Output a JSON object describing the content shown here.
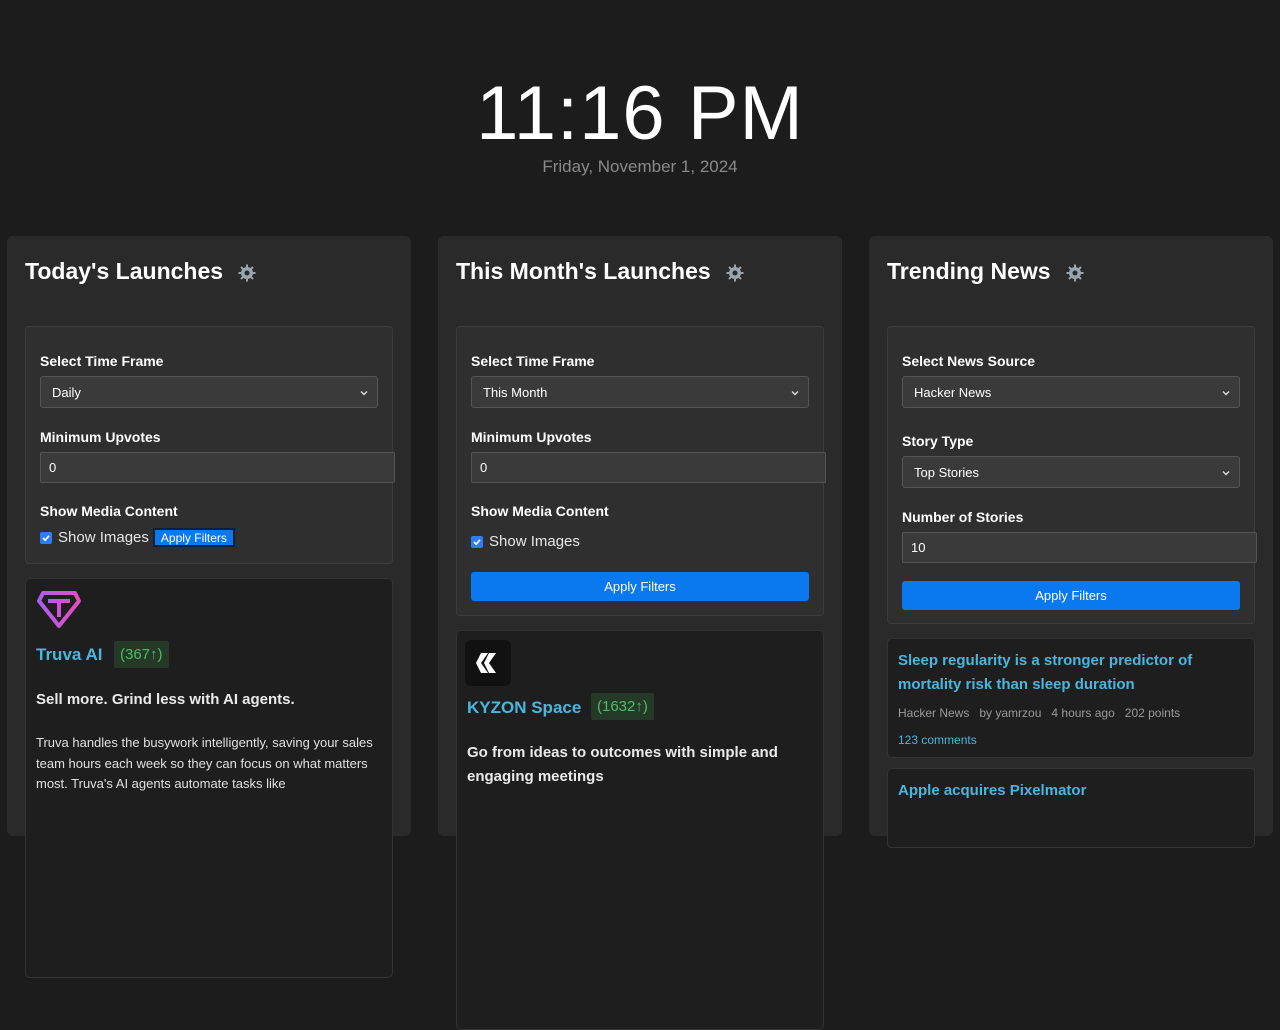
{
  "clock": {
    "time": "11:16 PM",
    "date": "Friday, November 1, 2024"
  },
  "panels": [
    {
      "title": "Today's Launches",
      "filters": {
        "timeframe_label": "Select Time Frame",
        "timeframe_value": "Daily",
        "upvotes_label": "Minimum Upvotes",
        "upvotes_value": "0",
        "media_label": "Show Media Content",
        "show_images_label": "Show Images",
        "apply_label": "Apply Filters"
      },
      "card": {
        "name": "Truva AI",
        "votes": "(367↑)",
        "tagline": "Sell more. Grind less with AI agents.",
        "description": "Truva handles the busywork intelligently, saving your sales team hours each week so they can focus on what matters most. Truva's AI agents automate tasks like"
      }
    },
    {
      "title": "This Month's Launches",
      "filters": {
        "timeframe_label": "Select Time Frame",
        "timeframe_value": "This Month",
        "upvotes_label": "Minimum Upvotes",
        "upvotes_value": "0",
        "media_label": "Show Media Content",
        "show_images_label": "Show Images",
        "apply_label": "Apply Filters"
      },
      "card": {
        "name": "KYZON Space",
        "votes": "(1632↑)",
        "tagline": "Go from ideas to outcomes with simple and engaging meetings"
      }
    },
    {
      "title": "Trending News",
      "filters": {
        "source_label": "Select News Source",
        "source_value": "Hacker News",
        "story_type_label": "Story Type",
        "story_type_value": "Top Stories",
        "count_label": "Number of Stories",
        "count_value": "10",
        "apply_label": "Apply Filters"
      },
      "stories": [
        {
          "title": "Sleep regularity is a stronger predictor of mortality risk than sleep duration",
          "source": "Hacker News",
          "by": "by yamrzou",
          "time": "4 hours ago",
          "points": "202 points",
          "comments": "123 comments"
        },
        {
          "title": "Apple acquires Pixelmator"
        }
      ]
    }
  ],
  "colors": {
    "accent": "#0a79f0",
    "link": "#49b6e0",
    "votes": "#52b96a",
    "background": "#1c1c1c",
    "panel": "#2a2a2a"
  },
  "icons": {
    "settings": "gear-icon",
    "dropdown": "chevron-down-icon",
    "checkbox": "checkbox-checked-icon"
  }
}
